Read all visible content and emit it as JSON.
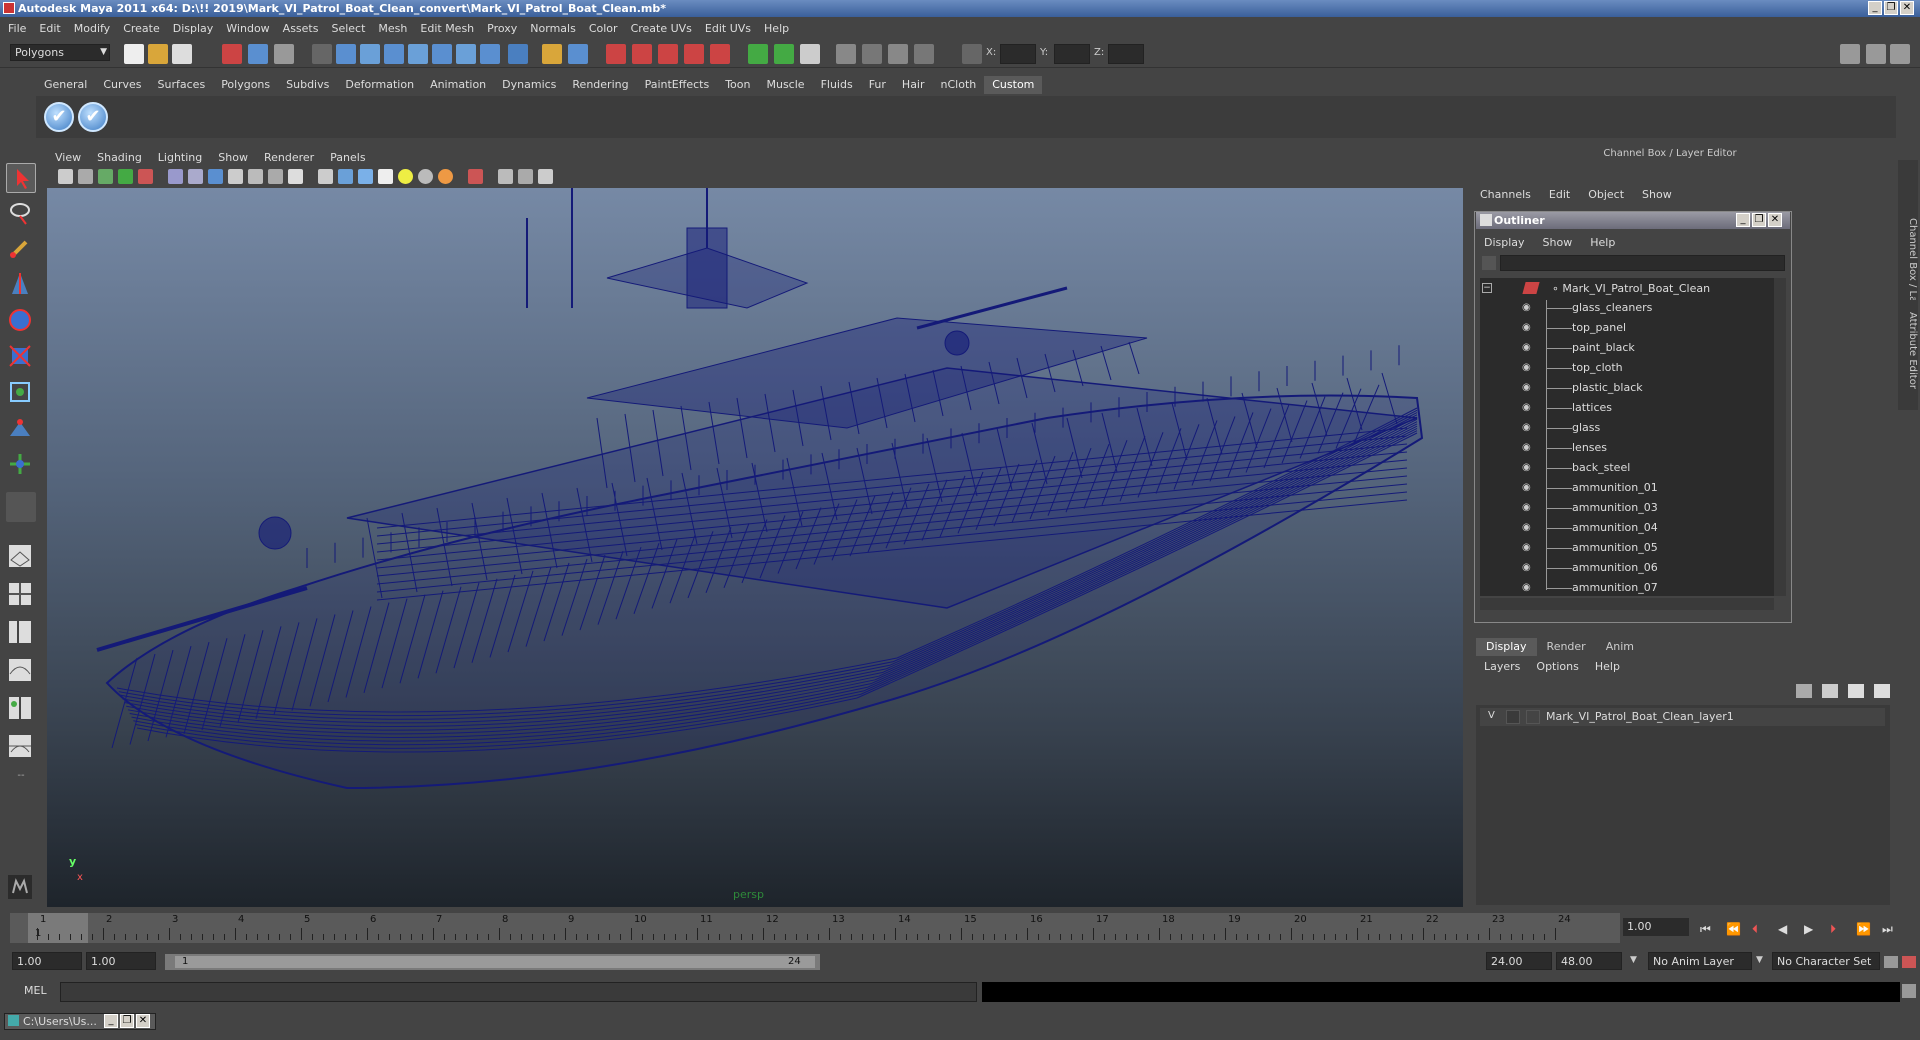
{
  "window": {
    "title": "Autodesk Maya 2011 x64: D:\\!! 2019\\Mark_VI_Patrol_Boat_Clean_convert\\Mark_VI_Patrol_Boat_Clean.mb*",
    "controls": [
      "_",
      "❐",
      "✕"
    ]
  },
  "menubar": [
    "File",
    "Edit",
    "Modify",
    "Create",
    "Display",
    "Window",
    "Assets",
    "Select",
    "Mesh",
    "Edit Mesh",
    "Proxy",
    "Normals",
    "Color",
    "Create UVs",
    "Edit UVs",
    "Help"
  ],
  "status_line": {
    "mode": "Polygons",
    "coord_labels": [
      "X:",
      "Y:",
      "Z:"
    ]
  },
  "shelf": {
    "tabs": [
      "General",
      "Curves",
      "Surfaces",
      "Polygons",
      "Subdivs",
      "Deformation",
      "Animation",
      "Dynamics",
      "Rendering",
      "PaintEffects",
      "Toon",
      "Muscle",
      "Fluids",
      "Fur",
      "Hair",
      "nCloth",
      "Custom"
    ],
    "active_tab": "Custom",
    "buttons": [
      "✔",
      "✔"
    ]
  },
  "viewport": {
    "menu": [
      "View",
      "Shading",
      "Lighting",
      "Show",
      "Renderer",
      "Panels"
    ],
    "camera_label": "persp",
    "axis_y": "y",
    "axis_x": "x",
    "wire_color": "#141a78"
  },
  "channel_box": {
    "title": "Channel Box / Layer Editor",
    "menu": [
      "Channels",
      "Edit",
      "Object",
      "Show"
    ],
    "side_tabs": [
      "Channel Box / Layer Editor",
      "Attribute Editor"
    ]
  },
  "outliner": {
    "title": "Outliner",
    "menu": [
      "Display",
      "Show",
      "Help"
    ],
    "root": "Mark_VI_Patrol_Boat_Clean",
    "items": [
      "glass_cleaners",
      "top_panel",
      "paint_black",
      "top_cloth",
      "plastic_black",
      "lattices",
      "glass",
      "lenses",
      "back_steel",
      "ammunition_01",
      "ammunition_03",
      "ammunition_04",
      "ammunition_05",
      "ammunition_06",
      "ammunition_07"
    ]
  },
  "layers": {
    "tabs": [
      "Display",
      "Render",
      "Anim"
    ],
    "active_tab": "Display",
    "menu": [
      "Layers",
      "Options",
      "Help"
    ],
    "rows": [
      {
        "visible": "V",
        "name": "Mark_VI_Patrol_Boat_Clean_layer1"
      }
    ]
  },
  "timeline": {
    "ticks": [
      "1",
      "2",
      "3",
      "4",
      "5",
      "6",
      "7",
      "8",
      "9",
      "10",
      "11",
      "12",
      "13",
      "14",
      "15",
      "16",
      "17",
      "18",
      "19",
      "20",
      "21",
      "22",
      "23",
      "24"
    ],
    "current_frame": "1.00",
    "current_marker": "1"
  },
  "range": {
    "start": "1.00",
    "playback_start": "1.00",
    "slider_start": "1",
    "slider_end": "24",
    "playback_end": "24.00",
    "end": "48.00",
    "anim_layer": "No Anim Layer",
    "character_set": "No Character Set"
  },
  "command_line": {
    "label": "MEL"
  },
  "taskbar": {
    "item": "C:\\Users\\Us..."
  }
}
